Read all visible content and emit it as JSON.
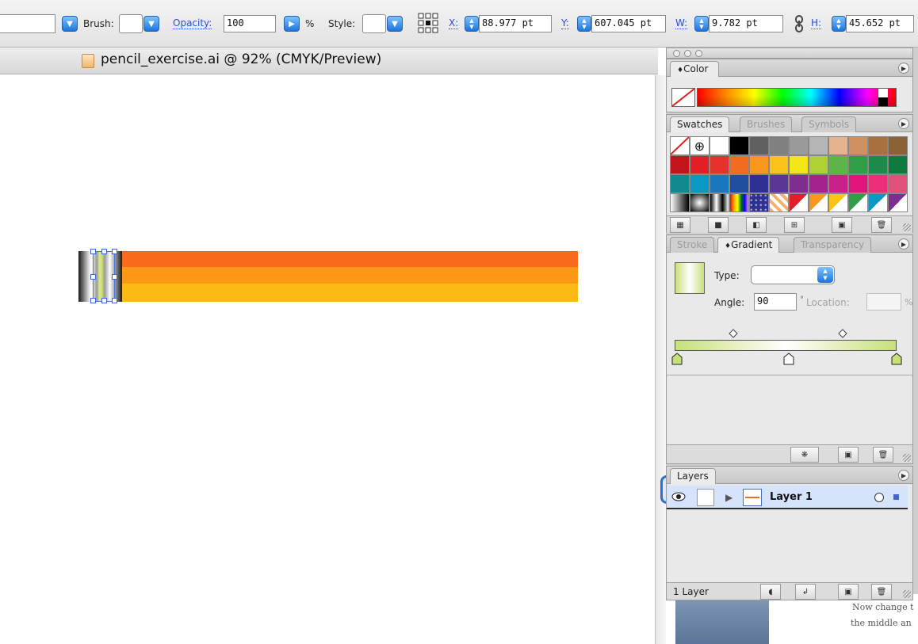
{
  "controlbar": {
    "brush_label": "Brush:",
    "opacity_label": "Opacity:",
    "opacity_value": "100",
    "percent": "%",
    "style_label": "Style:",
    "x_label": "X:",
    "x_value": "88.977 pt",
    "y_label": "Y:",
    "y_value": "607.045 pt",
    "w_label": "W:",
    "w_value": "9.782 pt",
    "h_label": "H:",
    "h_value": "45.652 pt"
  },
  "document": {
    "title": "pencil_exercise.ai @ 92% (CMYK/Preview)"
  },
  "pencil": {
    "stripe_colors": [
      "#f96a1c",
      "#fd9716",
      "#fdb914"
    ]
  },
  "color_panel": {
    "tab": "Color"
  },
  "swatches_panel": {
    "tabs": [
      "Swatches",
      "Brushes",
      "Symbols"
    ],
    "rows": [
      [
        "#ffffff",
        "#ffffff",
        "#ffffff",
        "#000000",
        "#606060",
        "#808080",
        "#9a9a9a",
        "#b5b5b5",
        "#e3b48f",
        "#cf915f",
        "#a6703f",
        "#8b6136"
      ],
      [
        "#c4151c",
        "#e21f26",
        "#e6322c",
        "#f26b21",
        "#f8971d",
        "#fbc217",
        "#f4e515",
        "#b0d136",
        "#5db547",
        "#2f9e45",
        "#1c8a4a",
        "#0f7a3d"
      ],
      [
        "#0f8a8e",
        "#0d97c5",
        "#1a77bd",
        "#1f4f9e",
        "#2e3192",
        "#5b3795",
        "#7d2e8f",
        "#a2238e",
        "#c9208a",
        "#e1147b",
        "#ec2e76",
        "#e2517c"
      ]
    ]
  },
  "gradient_panel": {
    "tabs": [
      "Stroke",
      "Gradient",
      "Transparency"
    ],
    "type_label": "Type:",
    "angle_label": "Angle:",
    "angle_value": "90",
    "degree": "°",
    "location_label": "Location:",
    "location_percent": "%"
  },
  "layers_panel": {
    "tab": "Layers",
    "layer_name": "Layer 1",
    "count": "1 Layer"
  },
  "background_note": {
    "line1": "Now change t",
    "line2": "the middle an"
  }
}
